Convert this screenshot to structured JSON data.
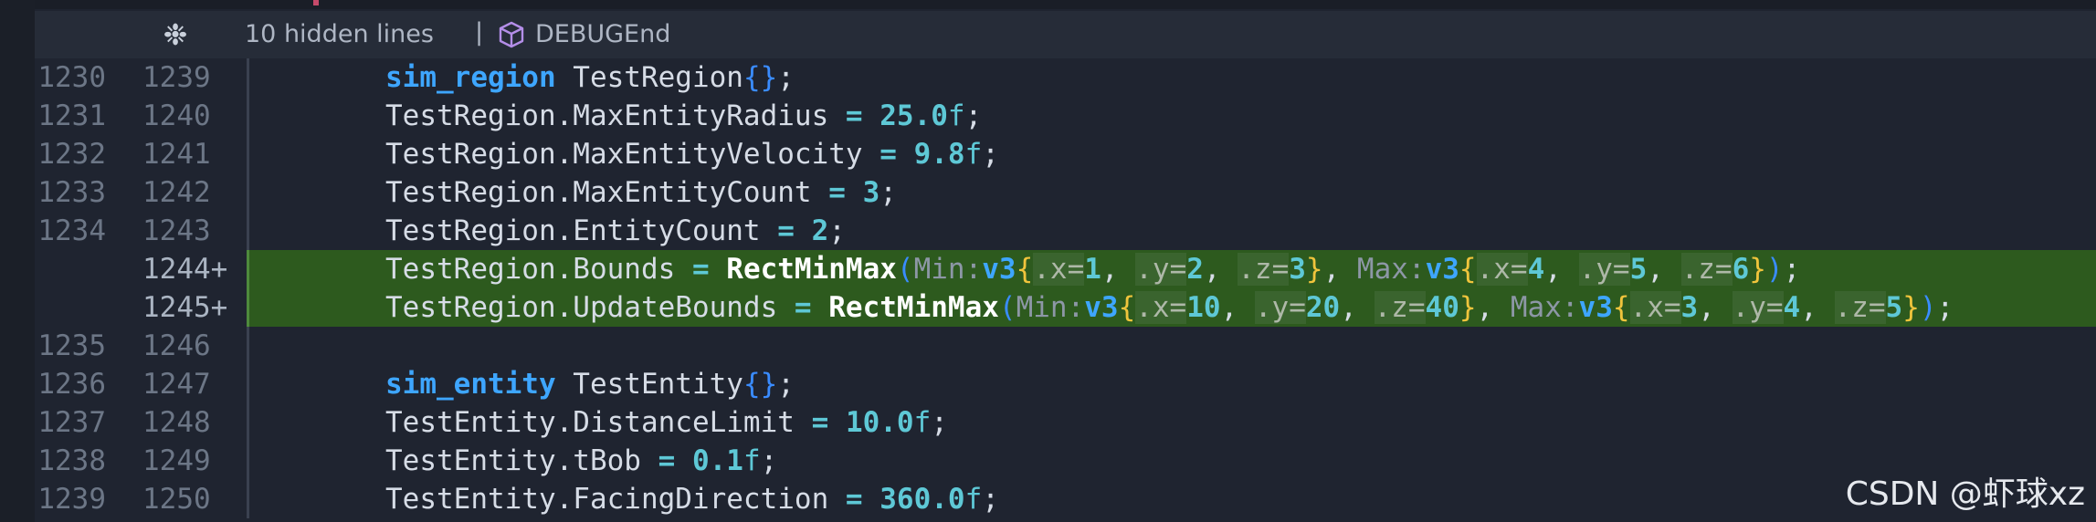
{
  "folded": {
    "hidden_text": "10 hidden lines",
    "separator": "|",
    "symbol": "DEBUGEnd"
  },
  "lines": [
    {
      "old": "1230",
      "new": "1239",
      "added": false
    },
    {
      "old": "1231",
      "new": "1240",
      "added": false
    },
    {
      "old": "1232",
      "new": "1241",
      "added": false
    },
    {
      "old": "1233",
      "new": "1242",
      "added": false
    },
    {
      "old": "1234",
      "new": "1243",
      "added": false
    },
    {
      "old": "",
      "new": "1244+",
      "added": true
    },
    {
      "old": "",
      "new": "1245+",
      "added": true
    },
    {
      "old": "1235",
      "new": "1246",
      "added": false
    },
    {
      "old": "1236",
      "new": "1247",
      "added": false
    },
    {
      "old": "1237",
      "new": "1248",
      "added": false
    },
    {
      "old": "1238",
      "new": "1249",
      "added": false
    },
    {
      "old": "1239",
      "new": "1250",
      "added": false
    }
  ],
  "code": {
    "l0": {
      "type": "sim_region",
      "var": " TestRegion",
      "open": "{",
      "close": "}",
      "end": ";"
    },
    "l1": {
      "lhs": "TestRegion.MaxEntityRadius",
      "eq": " = ",
      "val": "25.0",
      "suf": "f",
      "end": ";"
    },
    "l2": {
      "lhs": "TestRegion.MaxEntityVelocity",
      "eq": " = ",
      "val": "9.8",
      "suf": "f",
      "end": ";"
    },
    "l3": {
      "lhs": "TestRegion.MaxEntityCount",
      "eq": " = ",
      "val": "3",
      "end": ";"
    },
    "l4": {
      "lhs": "TestRegion.EntityCount",
      "eq": " = ",
      "val": "2",
      "end": ";"
    },
    "l5": {
      "lhs": "TestRegion.Bounds",
      "eq": " = ",
      "fn": "RectMinMax",
      "p_open": "(",
      "h_min": "Min:",
      "t": "v3",
      "b_open": "{",
      "x": ".x=",
      "xv": "1",
      "y": ".y=",
      "yv": "2",
      "z": ".z=",
      "zv": "3",
      "b_close": "}",
      "comma": ", ",
      "h_max": "Max:",
      "x2v": "4",
      "y2v": "5",
      "z2v": "6",
      "p_close": ")",
      "end": ";"
    },
    "l6": {
      "lhs": "TestRegion.UpdateBounds",
      "eq": " = ",
      "fn": "RectMinMax",
      "p_open": "(",
      "h_min": "Min:",
      "t": "v3",
      "b_open": "{",
      "x": ".x=",
      "xv": "10",
      "y": ".y=",
      "yv": "20",
      "z": ".z=",
      "zv": "40",
      "b_close": "}",
      "comma": ", ",
      "h_max": "Max:",
      "x2v": "3",
      "y2v": "4",
      "z2v": "5",
      "p_close": ")",
      "end": ";"
    },
    "l8": {
      "type": "sim_entity",
      "var": " TestEntity",
      "open": "{",
      "close": "}",
      "end": ";"
    },
    "l9": {
      "lhs": "TestEntity.DistanceLimit",
      "eq": " = ",
      "val": "10.0",
      "suf": "f",
      "end": ";"
    },
    "l10": {
      "lhs": "TestEntity.tBob",
      "eq": " = ",
      "val": "0.1",
      "suf": "f",
      "end": ";"
    },
    "l11": {
      "lhs": "TestEntity.FacingDirection",
      "eq": " = ",
      "val": "360.0",
      "suf": "f",
      "end": ";"
    }
  },
  "watermark": "CSDN @虾球xz",
  "icons": {
    "unfold": "unfold-icon",
    "symbol": "cube-icon"
  },
  "colors": {
    "added_bg": "#2d5a1e",
    "keyword": "#3ea6ff",
    "number": "#5ec8d6",
    "brace": "#f0c43c"
  }
}
